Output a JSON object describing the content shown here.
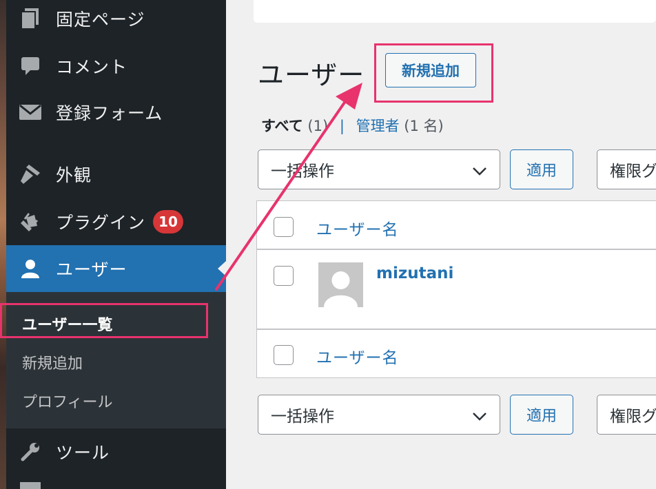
{
  "sidebar": {
    "menu": [
      {
        "label": "固定ページ",
        "icon": "pages-icon"
      },
      {
        "label": "コメント",
        "icon": "comment-icon"
      },
      {
        "label": "登録フォーム",
        "icon": "envelope-icon"
      },
      {
        "label": "外観",
        "icon": "paintbrush-icon"
      },
      {
        "label": "プラグイン",
        "icon": "plugin-icon",
        "badge": "10"
      },
      {
        "label": "ユーザー",
        "icon": "user-icon",
        "active": true
      },
      {
        "label": "ツール",
        "icon": "wrench-icon"
      }
    ],
    "submenu": [
      {
        "label": "ユーザー一覧",
        "current": true
      },
      {
        "label": "新規追加"
      },
      {
        "label": "プロフィール"
      }
    ]
  },
  "main": {
    "title": "ユーザー",
    "add_new_label": "新規追加",
    "filters": {
      "all_label": "すべて",
      "all_count": "(1)",
      "separator": "|",
      "admin_label": "管理者",
      "admin_count": "(1 名)"
    },
    "bulk_action_label": "一括操作",
    "apply_label": "適用",
    "role_select_label": "権限グ",
    "table": {
      "column_username": "ユーザー名",
      "rows": [
        {
          "username": "mizutani"
        }
      ]
    }
  },
  "colors": {
    "sidebar_bg": "#1d2327",
    "active_menu": "#2271b1",
    "link": "#2271b1",
    "badge": "#d63638",
    "highlight": "#e8336d"
  }
}
